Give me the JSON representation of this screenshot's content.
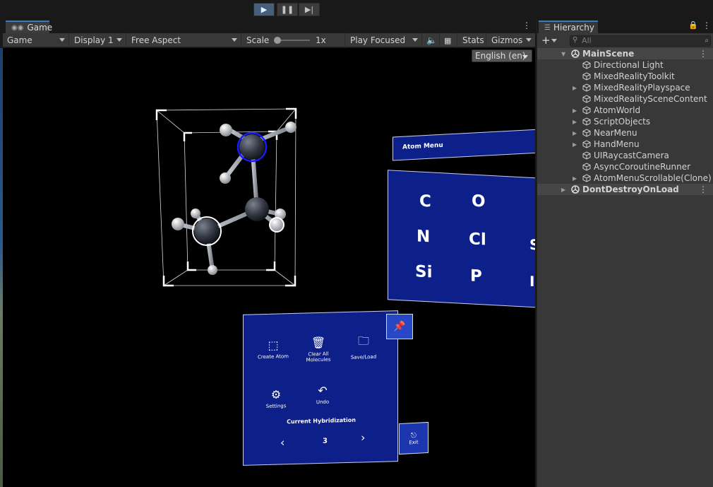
{
  "toolbar": {
    "play_icon": "play-icon",
    "pause_icon": "pause-icon",
    "step_icon": "step-icon"
  },
  "game": {
    "tab_label": "Game",
    "view_dropdown": "Game",
    "display_dropdown": "Display 1",
    "aspect_dropdown": "Free Aspect",
    "scale_label": "Scale",
    "scale_value": "1x",
    "play_mode_dropdown": "Play Focused",
    "stats_label": "Stats",
    "gizmos_label": "Gizmos",
    "language": "English (en)"
  },
  "scene": {
    "atom_menu_title": "Atom Menu",
    "elements": [
      "C",
      "O",
      "N",
      "Cl",
      "Si",
      "P"
    ],
    "hand_menu": {
      "buttons": [
        "Create Atom",
        "Clear All Molecules",
        "Save/Load",
        "Settings",
        "Undo"
      ],
      "hybridization_label": "Current Hybridization",
      "hybridization_value": "3",
      "exit_label": "Exit"
    }
  },
  "hierarchy": {
    "tab_label": "Hierarchy",
    "search_placeholder": "All",
    "items": [
      {
        "label": "MainScene",
        "level": 0,
        "expandable": true,
        "expanded": true,
        "scene": true
      },
      {
        "label": "Directional Light",
        "level": 1,
        "expandable": false
      },
      {
        "label": "MixedRealityToolkit",
        "level": 1,
        "expandable": false
      },
      {
        "label": "MixedRealityPlayspace",
        "level": 1,
        "expandable": true
      },
      {
        "label": "MixedRealitySceneContent",
        "level": 1,
        "expandable": false
      },
      {
        "label": "AtomWorld",
        "level": 1,
        "expandable": true
      },
      {
        "label": "ScriptObjects",
        "level": 1,
        "expandable": true
      },
      {
        "label": "NearMenu",
        "level": 1,
        "expandable": true
      },
      {
        "label": "HandMenu",
        "level": 1,
        "expandable": true
      },
      {
        "label": "UIRaycastCamera",
        "level": 1,
        "expandable": false
      },
      {
        "label": "AsyncCoroutineRunner",
        "level": 1,
        "expandable": false
      },
      {
        "label": "AtomMenuScrollable(Clone)",
        "level": 1,
        "expandable": true
      },
      {
        "label": "DontDestroyOnLoad",
        "level": 0,
        "expandable": true,
        "expanded": false,
        "scene": true
      }
    ]
  },
  "colors": {
    "panel_blue": "#0d1f88",
    "accent": "#3a79bb",
    "selection_ring": "#1a1aff"
  }
}
